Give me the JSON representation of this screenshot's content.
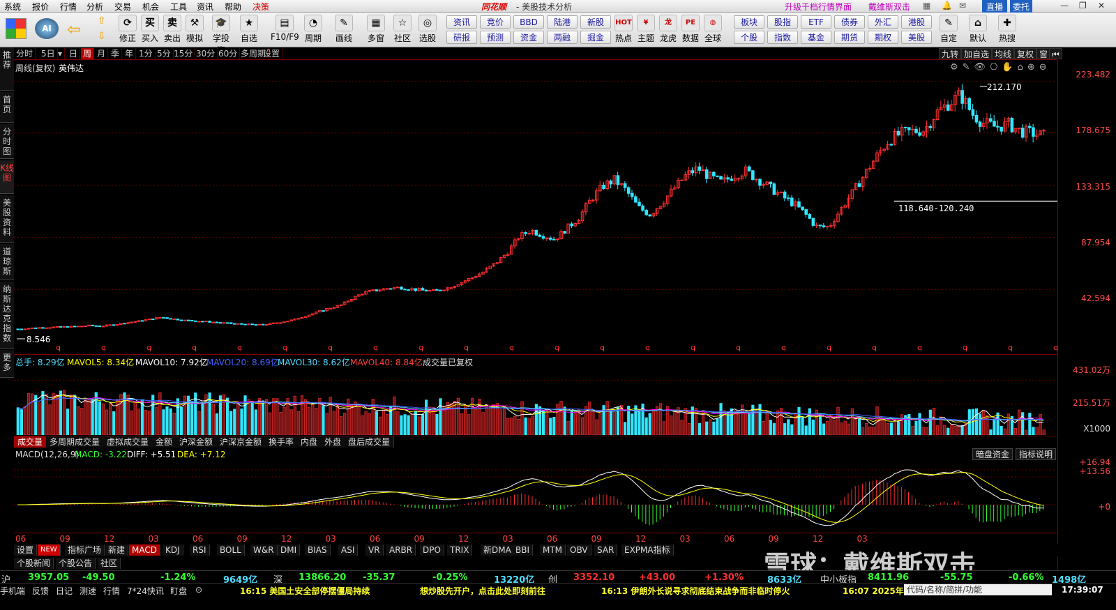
{
  "menu": {
    "items": [
      "系统",
      "报价",
      "行情",
      "分析",
      "交易",
      "机会",
      "工具",
      "资讯",
      "帮助",
      "决策"
    ],
    "brand": "同花顺",
    "window_title": "- 美股技术分析",
    "upgrade_link": "升级千档行情界面",
    "user": "戴维斯双击",
    "live_btn": "直播",
    "trust_btn": "委托"
  },
  "toolbar": {
    "main": [
      {
        "label": "修正",
        "glyph": "⟳"
      },
      {
        "label": "买入",
        "glyph": "买"
      },
      {
        "label": "卖出",
        "glyph": "卖"
      },
      {
        "label": "模拟",
        "glyph": "⚒"
      },
      {
        "label": "学投资",
        "glyph": "🎓"
      },
      {
        "label": "自选",
        "glyph": "★"
      },
      {
        "label": "F10/F9",
        "glyph": "▤"
      },
      {
        "label": "周期",
        "glyph": "◔"
      },
      {
        "label": "画线",
        "glyph": "✎"
      },
      {
        "label": "多窗",
        "glyph": "▦"
      },
      {
        "label": "社区",
        "glyph": "☆"
      },
      {
        "label": "选股",
        "glyph": "◎"
      }
    ],
    "grid_top": [
      "资讯",
      "竞价",
      "BBD",
      "陆港",
      "新股"
    ],
    "grid_bottom": [
      "研报",
      "预测",
      "资金",
      "两融",
      "掘金"
    ],
    "mid": [
      {
        "label": "热点",
        "glyph": "HOT"
      },
      {
        "label": "主题",
        "glyph": "¥"
      },
      {
        "label": "龙虎",
        "glyph": "龙"
      },
      {
        "label": "数据",
        "glyph": "PE"
      },
      {
        "label": "全球",
        "glyph": "◍"
      }
    ],
    "grid2_top": [
      "板块",
      "股指",
      "ETF",
      "债券",
      "外汇",
      "港股"
    ],
    "grid2_bottom": [
      "个股",
      "指数",
      "基金",
      "期货",
      "期权",
      "美股"
    ],
    "right": [
      {
        "label": "自定",
        "glyph": "✎"
      },
      {
        "label": "默认",
        "glyph": "⌂"
      },
      {
        "label": "热搜",
        "glyph": "✚"
      }
    ]
  },
  "sidenav": [
    "推荐",
    "首页",
    "分时图",
    "K线图",
    "美股资料",
    "道琼斯",
    "纳斯达克指数",
    "更多"
  ],
  "periods": [
    "分时",
    "5日",
    "▾",
    "日",
    "周",
    "月",
    "季",
    "年",
    "1分",
    "5分",
    "15分",
    "30分",
    "60分",
    "多周期",
    "设置"
  ],
  "active_period": "周",
  "right_buttons": [
    "九转",
    "加自选",
    "均线",
    "复权",
    "窗"
  ],
  "stock": {
    "mode": "周线(复权)",
    "name": "英伟达"
  },
  "price_axis": [
    "223.482",
    "178.675",
    "133.315",
    "87.954",
    "42.594"
  ],
  "annotations": {
    "high": "212.170",
    "low": "8.546",
    "gap": "118.640-120.240"
  },
  "volume": {
    "total": "总手: 8.29亿",
    "ma5": "MAVOL5: 8.34亿",
    "ma10": "MAVOL10: 7.92亿",
    "ma20": "MAVOL20: 8.69亿",
    "ma30": "MAVOL30: 8.62亿",
    "ma40": "MAVOL40: 8.84亿",
    "note": "成交量已复权",
    "axis": [
      "431.02万",
      "215.51万",
      "X1000"
    ]
  },
  "volume_tabs": [
    "成交量",
    "多周期成交量",
    "虚拟成交量",
    "金额",
    "沪深金额",
    "沪深京金额",
    "换手率",
    "内盘",
    "外盘",
    "盘后成交量"
  ],
  "macd": {
    "name": "MACD(12,26,9)",
    "macd": "MACD: -3.22",
    "diff": "DIFF: +5.51",
    "dea": "DEA: +7.12",
    "axis": [
      "+16.94",
      "+13.56",
      "+0"
    ],
    "btn1": "暗盘资金",
    "btn2": "指标说明"
  },
  "time_axis": [
    "06",
    "09",
    "12",
    "03",
    "06",
    "09",
    "12",
    "03",
    "06",
    "09",
    "12",
    "03",
    "06",
    "09",
    "12",
    "03",
    "06",
    "09",
    "12",
    "03"
  ],
  "indicator_tabs": [
    "设置",
    "NEW",
    "指标广场",
    "新建",
    "MACD",
    "KDJ",
    "RSI",
    "BOLL",
    "W&R",
    "DMI",
    "BIAS",
    "ASI",
    "VR",
    "ARBR",
    "DPO",
    "TRIX",
    "新DMA",
    "BBI",
    "MTM",
    "OBV",
    "SAR",
    "EXPMA指标"
  ],
  "active_indicator": "MACD",
  "bottom_tabs": [
    "个股新闻",
    "个股公告",
    "社区"
  ],
  "watermark": "雪球：戴维斯双击",
  "quotes": [
    {
      "name": "沪",
      "price": "3957.05",
      "chg": "-49.50",
      "pct": "-1.24%",
      "amt": "9649亿"
    },
    {
      "name": "深",
      "price": "13866.20",
      "chg": "-35.37",
      "pct": "-0.25%",
      "amt": "13220亿"
    },
    {
      "name": "创",
      "price": "3352.10",
      "chg": "+43.00",
      "pct": "+1.30%",
      "amt": "8633亿"
    },
    {
      "name": "中小板指",
      "price": "8411.96",
      "chg": "-55.75",
      "pct": "-0.66%",
      "amt": "1498亿"
    }
  ],
  "status_tabs": [
    "手机端",
    "反馈",
    "日记",
    "测速",
    "行情",
    "7*24快讯",
    "盯盘"
  ],
  "news": [
    "16:15 美国土安全部停摆僵局持续",
    "想炒股先开户，点击此处即刻前往",
    "16:13 伊朗外长说寻求彻底结束战争而非临时停火",
    "16:07 2025年"
  ],
  "search_placeholder": "代码/名称/简拼/功能",
  "clock": "17:39:07",
  "colors": {
    "up": "#ff3030",
    "down": "#33e6ff",
    "ma5": "#ffffff",
    "ma10": "#ffff00",
    "ma20": "#ff00ff",
    "ma30": "#00ff00",
    "ma40": "#4060ff",
    "diff": "#ffffff",
    "dea": "#ffff00"
  },
  "chart_data": {
    "type": "candlestick",
    "period": "weekly",
    "ylim": [
      0,
      230
    ],
    "close_series": [
      8.5,
      9.2,
      9.8,
      10.1,
      10.4,
      10.8,
      11.5,
      11.0,
      12.3,
      13.8,
      15.2,
      16.9,
      18.7,
      17.2,
      16.0,
      15.5,
      14.8,
      13.9,
      13.2,
      12.6,
      12.0,
      12.8,
      14.4,
      16.3,
      19.5,
      22.8,
      26.4,
      28.9,
      35.0,
      40.2,
      42.1,
      43.8,
      44.6,
      43.2,
      42.0,
      41.5,
      44.2,
      48.3,
      52.8,
      58.0,
      65.4,
      74.6,
      88.7,
      94.2,
      90.1,
      86.5,
      95.8,
      104.9,
      120.7,
      132.4,
      138.2,
      128.5,
      113.9,
      108.2,
      118.6,
      130.5,
      142.1,
      148.2,
      140.6,
      135.7,
      141.9,
      145.8,
      138.7,
      131.5,
      124.0,
      117.6,
      108.2,
      96.9,
      97.4,
      112.9,
      127.6,
      143.2,
      158.8,
      172.4,
      178.3,
      180.1,
      181.6,
      196.4,
      204.2,
      212.1,
      195.3,
      187.1,
      183.9,
      186.5,
      180.2,
      178.6,
      176.4
    ]
  }
}
